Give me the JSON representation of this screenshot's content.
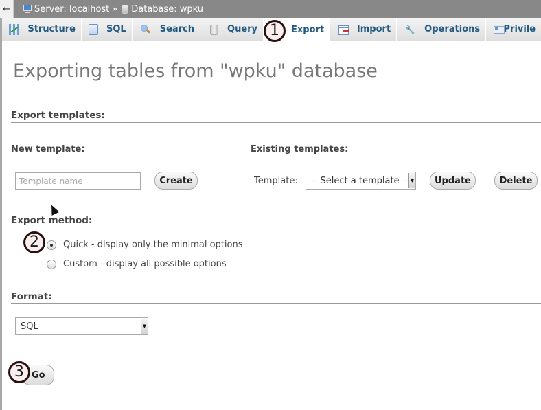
{
  "breadcrumb": {
    "back_label": "←",
    "server": "Server: localhost",
    "separator": "»",
    "database": "Database: wpku"
  },
  "tabs": [
    {
      "label": "Structure",
      "icon": "structure-icon"
    },
    {
      "label": "SQL",
      "icon": "sql-scroll-icon"
    },
    {
      "label": "Search",
      "icon": "magnifier-icon"
    },
    {
      "label": "Query",
      "icon": "database-cylinder-icon"
    },
    {
      "label": "Export",
      "icon": "export-icon",
      "active": true
    },
    {
      "label": "Import",
      "icon": "import-icon"
    },
    {
      "label": "Operations",
      "icon": "wrench-icon"
    },
    {
      "label": "Privile",
      "icon": "id-card-icon"
    }
  ],
  "annotations": [
    "1",
    "2",
    "3"
  ],
  "page_title": "Exporting tables from \"wpku\" database",
  "templates": {
    "section_title": "Export templates:",
    "new_label": "New template:",
    "existing_label": "Existing templates:",
    "name_placeholder": "Template name",
    "name_value": "",
    "create_label": "Create",
    "template_label": "Template:",
    "template_select": "-- Select a template --",
    "update_label": "Update",
    "delete_label": "Delete"
  },
  "export_method": {
    "section_title": "Export method:",
    "options": [
      {
        "label": "Quick - display only the minimal options",
        "checked": true
      },
      {
        "label": "Custom - display all possible options",
        "checked": false
      }
    ]
  },
  "format": {
    "section_title": "Format:",
    "selected": "SQL"
  },
  "go_label": "Go"
}
